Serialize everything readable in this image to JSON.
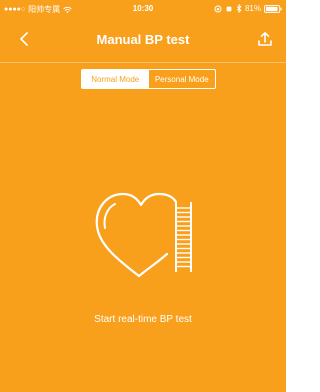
{
  "colors": {
    "background": "#F8A01B",
    "foreground": "#FFFFFF"
  },
  "status_bar": {
    "signal": "●●●●○",
    "carrier": "阳帅专属",
    "time": "10:30",
    "battery_percent": "81%"
  },
  "nav": {
    "title": "Manual BP test",
    "back_icon": "chevron-left-icon",
    "share_icon": "share-upload-icon"
  },
  "mode_switch": {
    "options": [
      "Normal Mode",
      "Personal Mode"
    ],
    "selected": "Normal Mode"
  },
  "main": {
    "illustration_icon": "heart-ladder-icon",
    "start_label": "Start real-time BP test"
  }
}
